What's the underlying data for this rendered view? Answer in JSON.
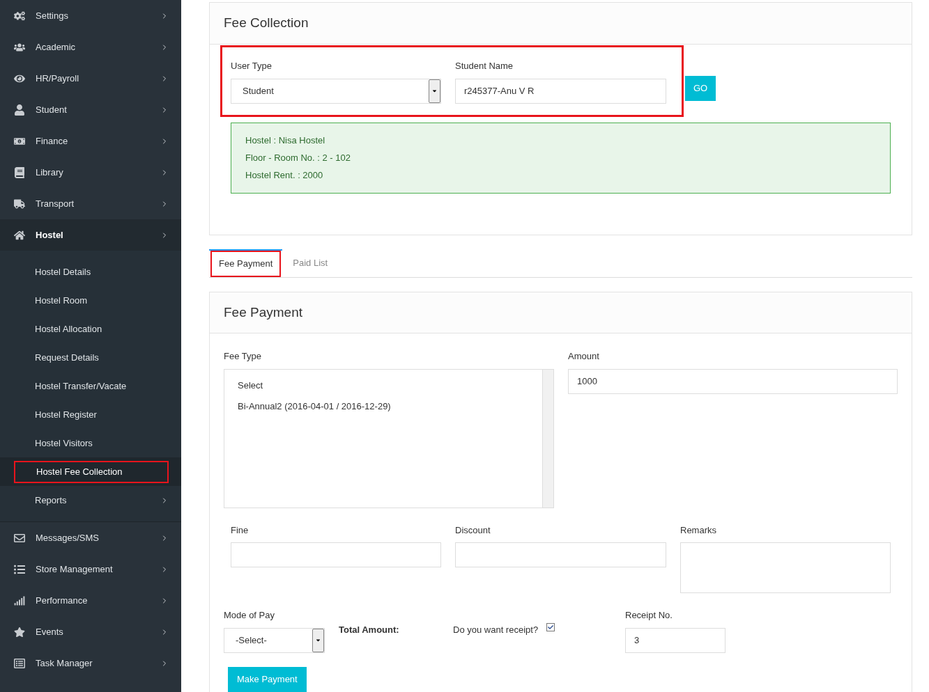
{
  "sidebar": {
    "items": [
      {
        "label": "Settings",
        "expanded": false
      },
      {
        "label": "Academic",
        "expanded": false
      },
      {
        "label": "HR/Payroll",
        "expanded": false
      },
      {
        "label": "Student",
        "expanded": false
      },
      {
        "label": "Finance",
        "expanded": false
      },
      {
        "label": "Library",
        "expanded": false
      },
      {
        "label": "Transport",
        "expanded": false
      },
      {
        "label": "Hostel",
        "expanded": true,
        "children": [
          {
            "label": "Hostel Details",
            "selected": false,
            "submenu": false
          },
          {
            "label": "Hostel Room",
            "selected": false,
            "submenu": false
          },
          {
            "label": "Hostel Allocation",
            "selected": false,
            "submenu": false
          },
          {
            "label": "Request Details",
            "selected": false,
            "submenu": false
          },
          {
            "label": "Hostel Transfer/Vacate",
            "selected": false,
            "submenu": false
          },
          {
            "label": "Hostel Register",
            "selected": false,
            "submenu": false
          },
          {
            "label": "Hostel Visitors",
            "selected": false,
            "submenu": false
          },
          {
            "label": "Hostel Fee Collection",
            "selected": true,
            "submenu": false
          },
          {
            "label": "Reports",
            "selected": false,
            "submenu": true
          }
        ]
      },
      {
        "label": "Messages/SMS",
        "expanded": false
      },
      {
        "label": "Store Management",
        "expanded": false
      },
      {
        "label": "Performance",
        "expanded": false
      },
      {
        "label": "Events",
        "expanded": false
      },
      {
        "label": "Task Manager",
        "expanded": false
      }
    ]
  },
  "fee_collection": {
    "title": "Fee Collection",
    "user_type": {
      "label": "User Type",
      "value": "Student"
    },
    "student_name": {
      "label": "Student Name",
      "value": "r245377-Anu V R"
    },
    "go_button": "GO",
    "info": [
      "Hostel : Nisa Hostel",
      "Floor - Room No. : 2 - 102",
      "Hostel Rent. : 2000"
    ]
  },
  "tabs": [
    {
      "label": "Fee Payment",
      "selected": true
    },
    {
      "label": "Paid List",
      "selected": false
    }
  ],
  "fee_payment": {
    "title": "Fee Payment",
    "fee_type": {
      "label": "Fee Type",
      "options": [
        "Select",
        "Bi-Annual2 (2016-04-01 / 2016-12-29)"
      ]
    },
    "amount": {
      "label": "Amount",
      "value": "1000"
    },
    "fine": {
      "label": "Fine"
    },
    "discount": {
      "label": "Discount"
    },
    "remarks": {
      "label": "Remarks"
    },
    "mode_of_pay": {
      "label": "Mode of Pay",
      "value": "-Select-"
    },
    "total_amount": {
      "label": "Total Amount:"
    },
    "receipt": {
      "label": "Do you want receipt?",
      "checked": true
    },
    "receipt_no": {
      "label": "Receipt No.",
      "value": "3"
    },
    "submit": "Make Payment"
  }
}
